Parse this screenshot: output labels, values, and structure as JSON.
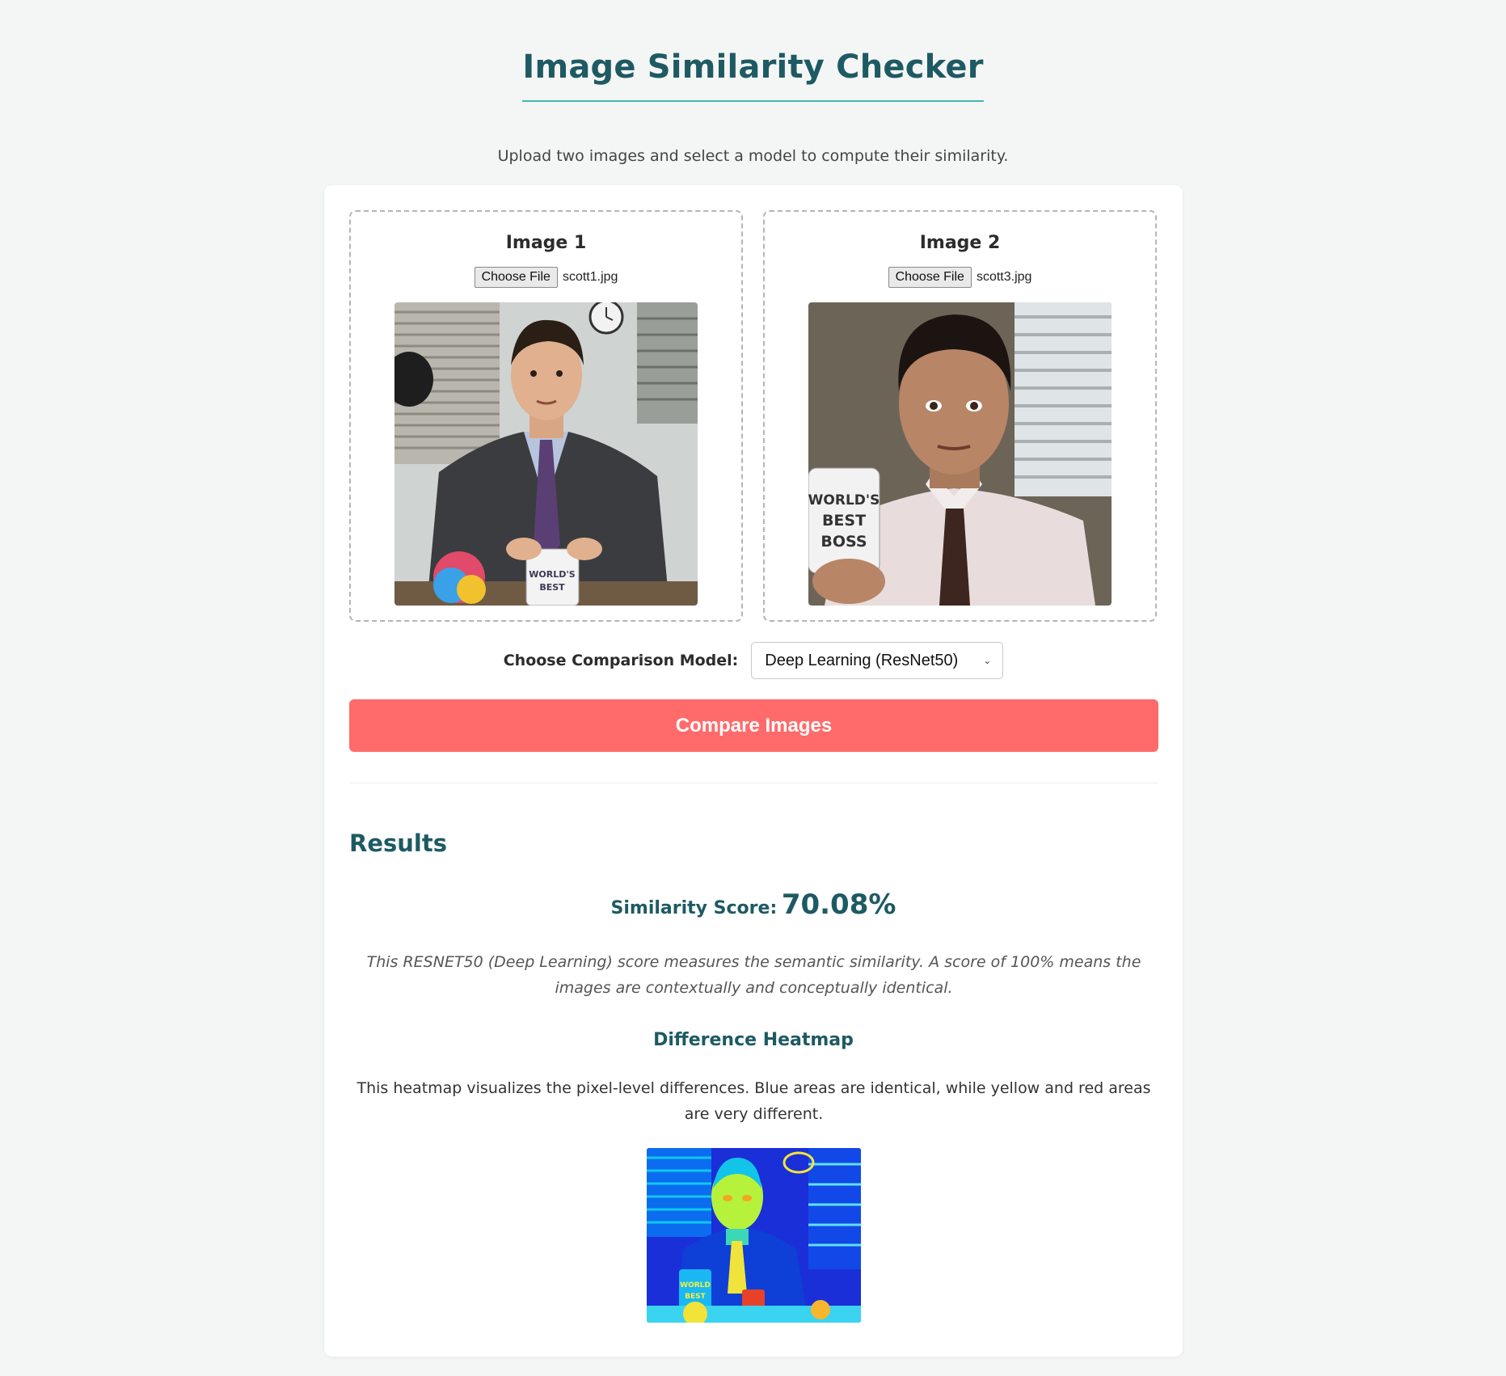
{
  "header": {
    "title": "Image Similarity Checker",
    "subtitle": "Upload two images and select a model to compute their similarity."
  },
  "uploads": [
    {
      "title": "Image 1",
      "button_label": "Choose File",
      "file_name": "scott1.jpg"
    },
    {
      "title": "Image 2",
      "button_label": "Choose File",
      "file_name": "scott3.jpg"
    }
  ],
  "model": {
    "label": "Choose Comparison Model:",
    "selected": "Deep Learning (ResNet50)"
  },
  "compare_button": "Compare Images",
  "results": {
    "heading": "Results",
    "score_label": "Similarity Score:",
    "score_value": "70.08%",
    "score_note": "This RESNET50 (Deep Learning) score measures the semantic similarity. A score of 100% means the images are contextually and conceptually identical.",
    "heatmap_heading": "Difference Heatmap",
    "heatmap_description": "This heatmap visualizes the pixel-level differences. Blue areas are identical, while yellow and red areas are very different."
  },
  "colors": {
    "title": "#1e5a63",
    "accent_underline": "#3fb8ad",
    "compare_button": "#ff6b6b",
    "page_background": "#f4f6f5"
  },
  "icons": {
    "select_chevron": "chevron-down-icon"
  }
}
